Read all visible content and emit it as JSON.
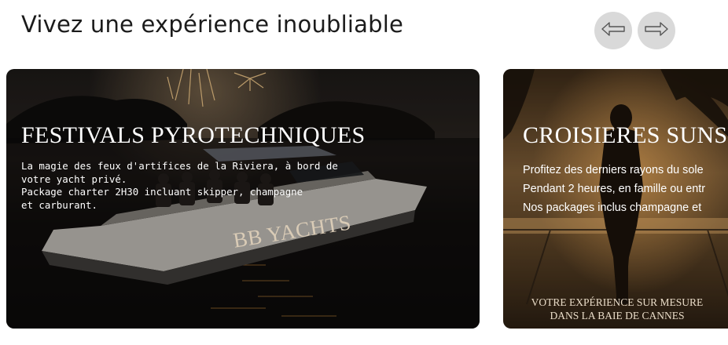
{
  "section": {
    "title": "Vivez une expérience inoubliable"
  },
  "nav": {
    "prev_icon": "arrow-left-icon",
    "next_icon": "arrow-right-icon"
  },
  "cards": [
    {
      "title": "FESTIVALS PYROTECHNIQUES",
      "description": [
        "La magie des feux d'artifices de la Riviera, à bord de",
        "votre yacht privé.",
        "Package charter 2H30 incluant skipper, champagne",
        "et carburant."
      ],
      "image_text": "BB YACHTS"
    },
    {
      "title": "CROISIERES SUNS",
      "description": [
        "Profitez des derniers rayons du sole",
        "Pendant 2 heures, en famille ou entr",
        "Nos packages inclus champagne et"
      ],
      "image_text": [
        "VOTRE EXPÉRIENCE SUR MESURE",
        "DANS LA BAIE DE CANNES"
      ]
    }
  ],
  "colors": {
    "title_text": "#1b1b1b",
    "nav_button_bg": "#d9d9d9",
    "card_text": "#ffffff"
  }
}
